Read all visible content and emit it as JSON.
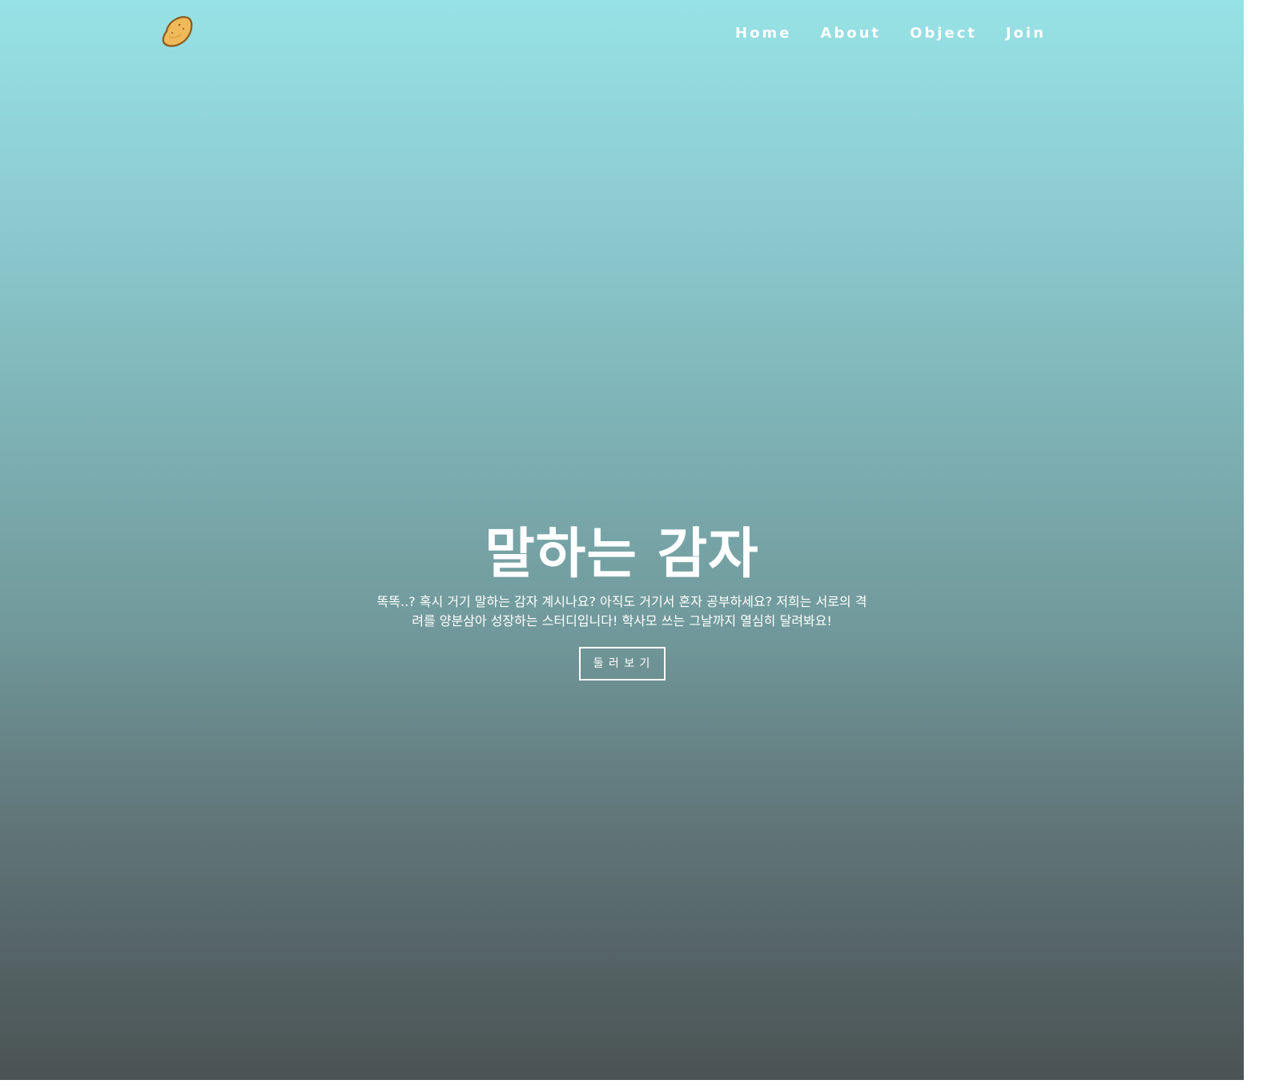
{
  "navbar": {
    "logo_icon": "potato-icon",
    "links": [
      {
        "label": "Home"
      },
      {
        "label": "About"
      },
      {
        "label": "Object"
      },
      {
        "label": "Join"
      }
    ]
  },
  "hero": {
    "title": "말하는 감자",
    "description_line1": "똑똑..? 혹시 거기 말하는 감자 계시나요? 아직도 거기서 혼자 공부하세요? 저희는 서로의 격",
    "description_line2": "려를 양분삼아 성장하는 스터디입니다! 학사모 쓰는 그날까지 열심히 달려봐요!",
    "button_label": "둘 러 보 기"
  },
  "colors": {
    "gradient_top": "#97e2e6",
    "gradient_bottom": "#4a5354",
    "logo_fill": "#f0b95a",
    "logo_stroke": "#8a5a1e",
    "text": "#ffffff"
  }
}
